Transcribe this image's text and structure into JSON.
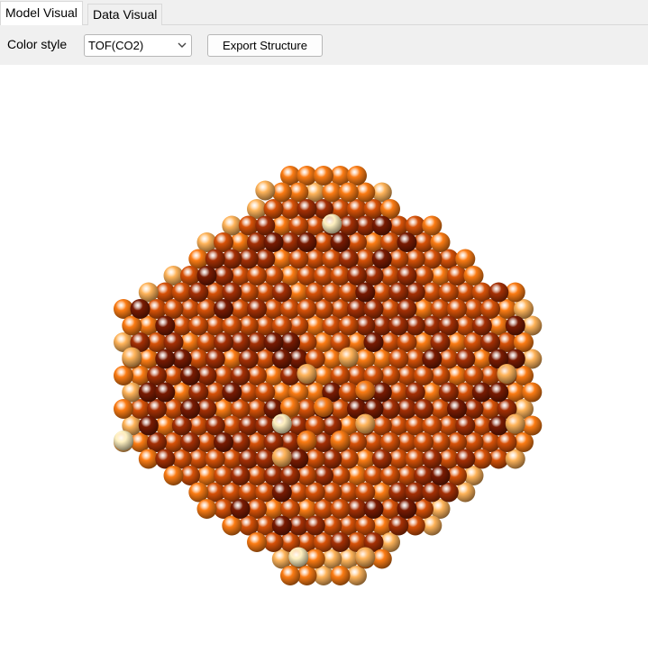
{
  "tabs": [
    {
      "label": "Model Visual",
      "active": true
    },
    {
      "label": "Data Visual",
      "active": false
    }
  ],
  "toolbar": {
    "color_style_label": "Color style",
    "color_style_value": "TOF(CO2)",
    "export_label": "Export Structure"
  },
  "viewer": {
    "colormap": [
      "#fff1c0",
      "#ffb45a",
      "#fc7c14",
      "#d85208",
      "#a63005",
      "#7a1b02"
    ]
  }
}
